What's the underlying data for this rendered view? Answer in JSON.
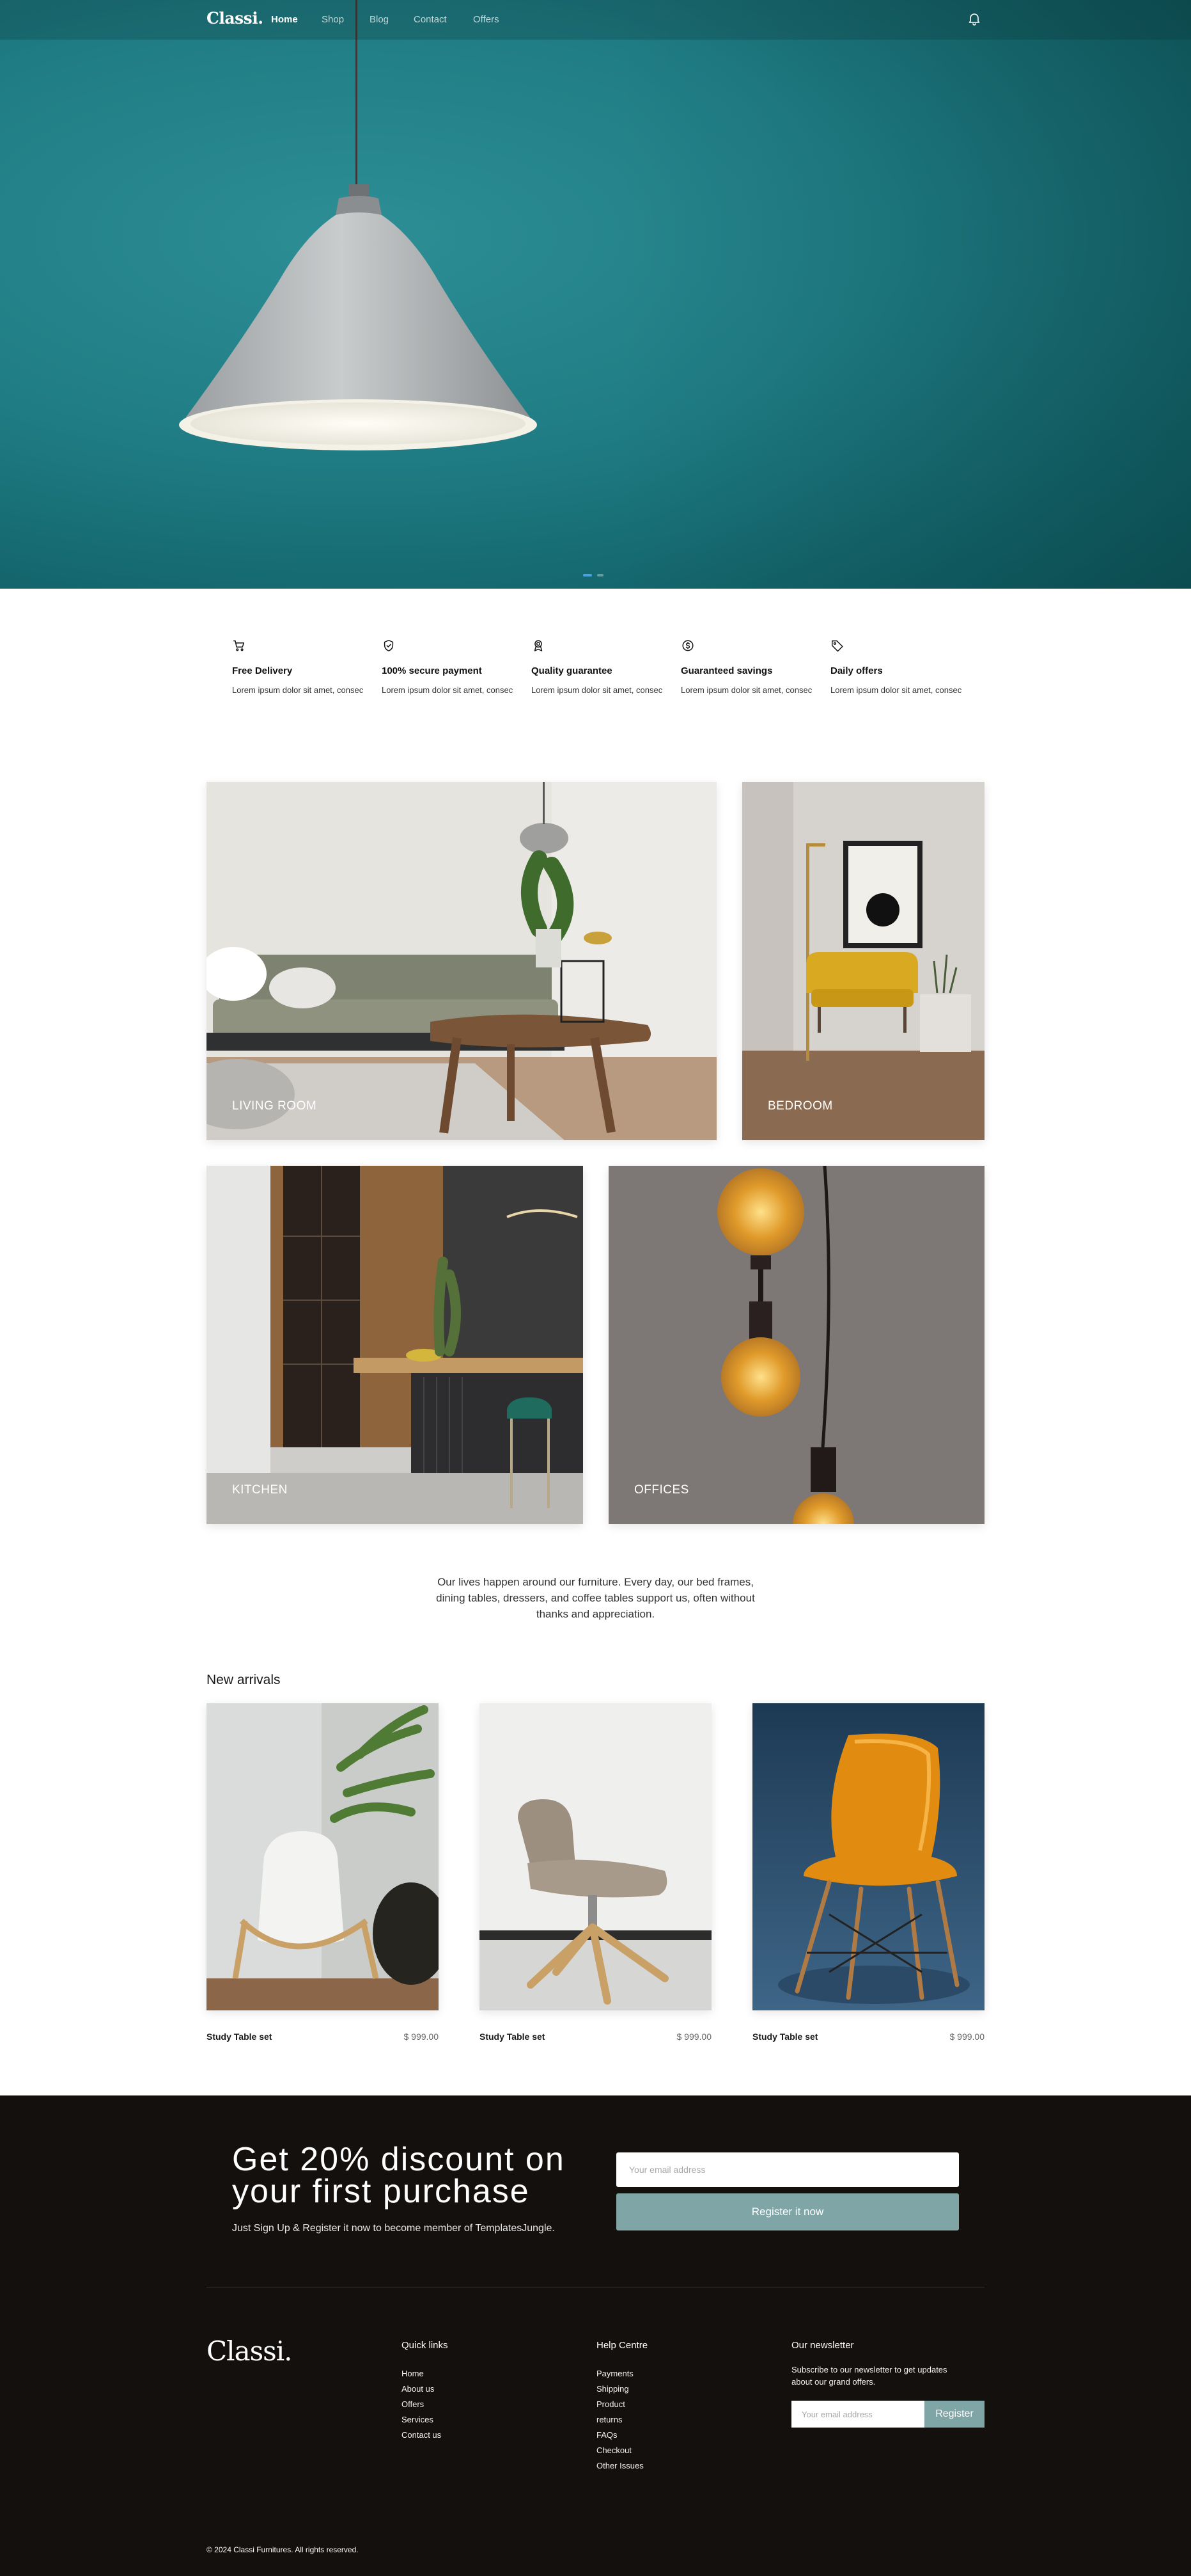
{
  "nav": {
    "logo": "Classi.",
    "items": [
      {
        "label": "Home",
        "active": true
      },
      {
        "label": "Shop",
        "active": false
      },
      {
        "label": "Blog",
        "active": false
      },
      {
        "label": "Contact",
        "active": false
      },
      {
        "label": "Offers",
        "active": false
      }
    ],
    "bell_icon": "bell-icon"
  },
  "hero": {
    "background_color": "#1f7c84",
    "slider": {
      "slides": 2,
      "active_slide": 1
    }
  },
  "features": [
    {
      "icon": "cart-icon",
      "title": "Free Delivery",
      "text": "Lorem ipsum dolor sit amet, consectetur adipi elit. Ipsum dolor..."
    },
    {
      "icon": "shield-check-icon",
      "title": "100% secure payment",
      "text": "Lorem ipsum dolor sit amet, consectetur adipi elit. Ipsum dolor..."
    },
    {
      "icon": "award-icon",
      "title": "Quality guarantee",
      "text": "Lorem ipsum dolor sit amet, consectetur adipi elit. Ipsum dolor..."
    },
    {
      "icon": "coin-icon",
      "title": "Guaranteed savings",
      "text": "Lorem ipsum dolor sit amet, consectetur adipi elit. Ipsum dolor..."
    },
    {
      "icon": "tag-icon",
      "title": "Daily offers",
      "text": "Lorem ipsum dolor sit amet, consectetur adipi elit. Ipsum dolor..."
    }
  ],
  "categories": [
    {
      "label": "LIVING ROOM"
    },
    {
      "label": "BEDROOM"
    },
    {
      "label": "KITCHEN"
    },
    {
      "label": "OFFICES"
    }
  ],
  "quote": "Our lives happen around our furniture. Every day, our bed frames, dining tables, dressers, and coffee tables support us, often without thanks and appreciation.",
  "new_arrivals": {
    "title": "New arrivals",
    "products": [
      {
        "name": "Study Table set",
        "price": "$ 999.00"
      },
      {
        "name": "Study Table set",
        "price": "$ 999.00"
      },
      {
        "name": "Study Table set",
        "price": "$ 999.00"
      }
    ]
  },
  "promo": {
    "title_line1": "Get 20% discount on",
    "title_line2": "your first purchase",
    "subtitle": "Just Sign Up & Register it now to become member of TemplatesJungle.",
    "email_placeholder": "Your email address",
    "button": "Register it now"
  },
  "footer": {
    "logo": "Classi.",
    "quick_links": {
      "title": "Quick links",
      "items": [
        "Home",
        "About us",
        "Offers",
        "Services",
        "Contact us"
      ]
    },
    "help_centre": {
      "title": "Help Centre",
      "items": [
        "Payments",
        "Shipping",
        "Product",
        "returns",
        "FAQs",
        "Checkout",
        "Other Issues"
      ]
    },
    "newsletter": {
      "title": "Our newsletter",
      "text": "Subscribe to our newsletter to get updates about our grand offers.",
      "email_placeholder": "Your email address",
      "button": "Register"
    },
    "copyright": "© 2024 Classi Furnitures. All rights reserved."
  },
  "colors": {
    "hero_teal": "#1f7c84",
    "footer_bg": "#14100e",
    "button_sage": "#7fa5a6"
  }
}
